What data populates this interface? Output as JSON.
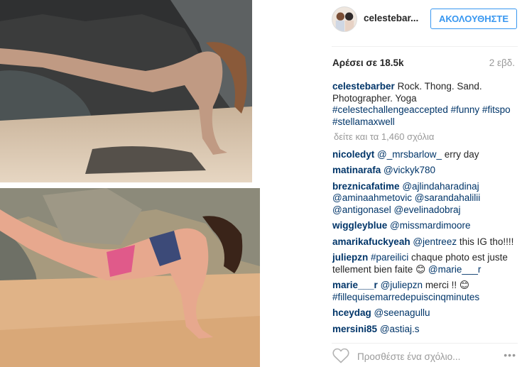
{
  "header": {
    "username": "celestebar...",
    "follow_label": "ΑΚΟΛΟΥΘΗΣΤΕ"
  },
  "meta": {
    "likes": "Αρέσει σε 18.5k",
    "time": "2 εβδ."
  },
  "caption": {
    "user": "celestebarber",
    "text": "Rock. Thong. Sand. Photographer. Yoga",
    "hashtags": "#celestechallengeaccepted #funny #fitspo #stellamaxwell"
  },
  "view_all": "δείτε και τα 1,460 σχόλια",
  "comments": [
    {
      "user": "nicoledyt",
      "mention": "@_mrsbarlow_",
      "text": " erry day"
    },
    {
      "user": "matinarafa",
      "mention": "@vickyk780",
      "text": ""
    },
    {
      "user": "breznicafatime",
      "mention": "@ajlindaharadinaj @aminaahmetovic @sarandahalilii @antigonasel @evelinadobraj",
      "text": ""
    },
    {
      "user": "wiggleyblue",
      "mention": "@missmardimoore",
      "text": ""
    },
    {
      "user": "amarikafuckyeah",
      "mention": "@jentreez",
      "text": " this IG tho!!!!"
    },
    {
      "user": "juliepzn",
      "mention": "#pareilici",
      "text": " chaque photo est juste tellement bien faite 😊 ",
      "mention2": "@marie___r"
    },
    {
      "user": "marie___r",
      "mention": "@juliepzn",
      "text": " merci !! 😊 ",
      "mention2": "#fillequisemarredepuiscinqminutes"
    },
    {
      "user": "hceydag",
      "mention": "@seenagullu",
      "text": ""
    },
    {
      "user": "mersini85",
      "mention": "@astiaj.s",
      "text": ""
    }
  ],
  "footer": {
    "add_comment_placeholder": "Προσθέστε ένα σχόλιο...",
    "more": "•••"
  },
  "icons": {
    "heart": "heart-outline-icon",
    "more": "more-options-icon"
  }
}
